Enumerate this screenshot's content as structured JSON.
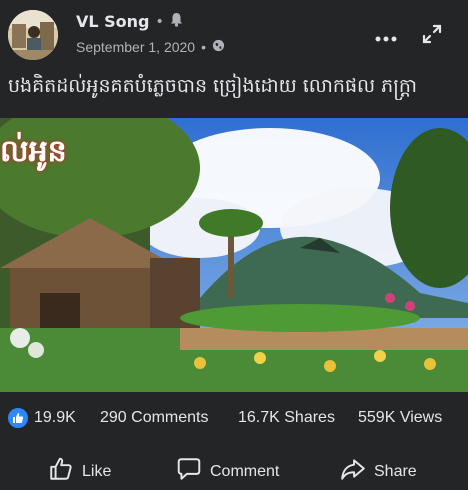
{
  "post": {
    "author": "VL Song",
    "separator": "•",
    "date": "September 1, 2020",
    "caption": "បងគិតដល់អូនគតបំភ្លេចបាន ច្រៀងដោយ លោកផល ភក្ត្រា",
    "video_overlay_text": "ល់អូន"
  },
  "stats": {
    "likes": "19.9K",
    "comments": "290 Comments",
    "shares": "16.7K Shares",
    "views": "559K Views"
  },
  "actions": {
    "like": "Like",
    "comment": "Comment",
    "share": "Share"
  },
  "icons": {
    "notifications": "bell-icon",
    "privacy": "globe-icon",
    "more": "more-dots-icon",
    "expand": "expand-icon",
    "like_badge": "thumbs-up-icon",
    "like_action": "thumbs-up-outline-icon",
    "comment_action": "comment-bubble-icon",
    "share_action": "share-arrow-icon"
  },
  "colors": {
    "background": "#242526",
    "text": "#e4e6eb",
    "secondary_text": "#b0b3b8",
    "like_blue": "#2d88ff"
  }
}
